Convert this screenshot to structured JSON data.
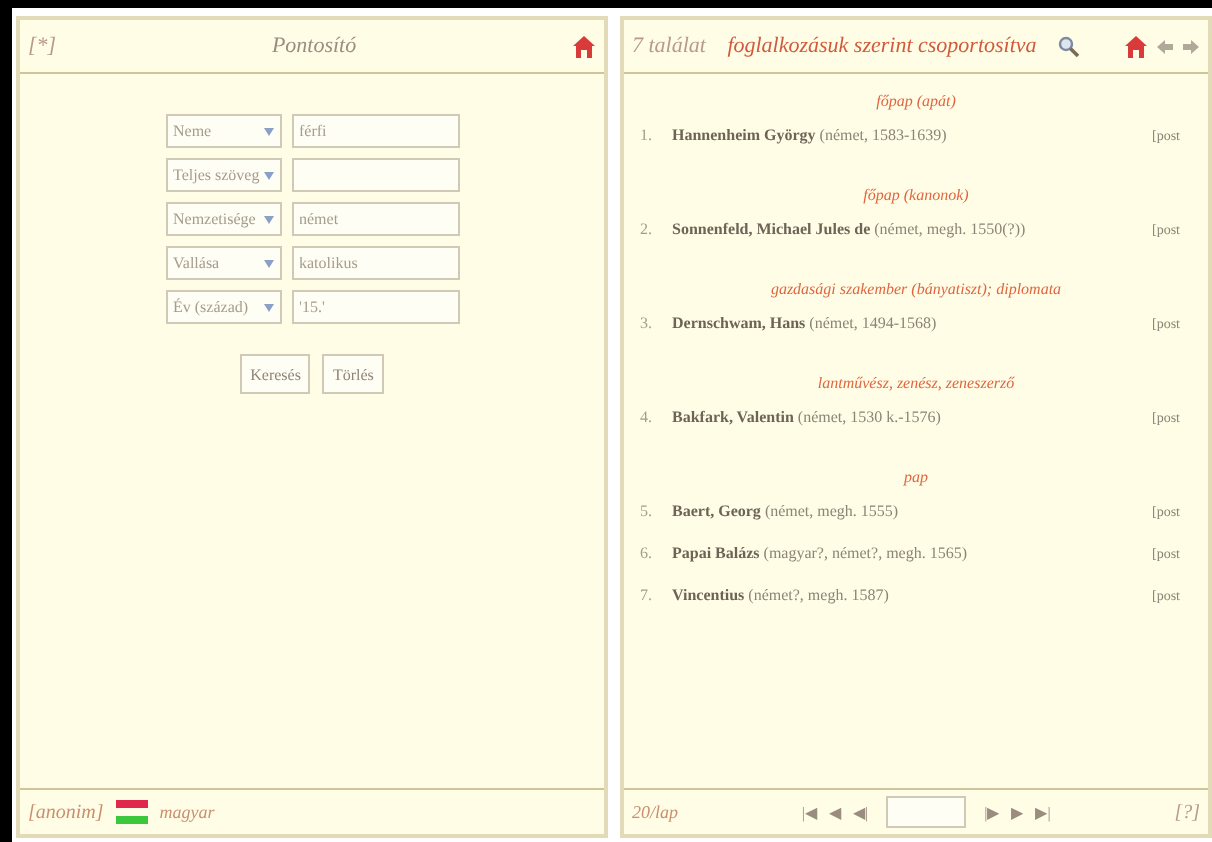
{
  "left_panel": {
    "marker": "[*]",
    "title": "Pontosító",
    "criteria": [
      {
        "field": "Neme",
        "value": "férfi"
      },
      {
        "field": "Teljes szöveg"
      },
      {
        "field": "Nemzetisége",
        "value": "német"
      },
      {
        "field": "Vallása",
        "value": "katolikus"
      },
      {
        "field": "Év (század)",
        "value": "'15.'"
      }
    ],
    "buttons": [
      "Keresés",
      "Törlés"
    ],
    "footer": {
      "user": "[anonim]",
      "language": "magyar"
    }
  },
  "right_panel": {
    "count": "7 találat",
    "title": "foglalkozásuk szerint csoportosítva",
    "groups": [
      {
        "label": "főpap (apát)",
        "entries": [
          {
            "number": "1.",
            "text": "**Hannenheim György** (német, 1583-1639)",
            "link": "[post"
          }
        ]
      },
      {
        "label": "főpap (kanonok)",
        "entries": [
          {
            "number": "2.",
            "text": "**Sonnenfeld, Michael Jules de** (német, megh. 1550(?))",
            "link": "[post"
          }
        ]
      },
      {
        "label": "gazdasági szakember (bányatiszt); diplomata",
        "entries": [
          {
            "number": "3.",
            "text": "**Dernschwam, Hans** (német, 1494-1568)",
            "link": "[post"
          }
        ]
      },
      {
        "label": "lantművész, zenész, zeneszerző",
        "entries": [
          {
            "number": "4.",
            "text": "**Bakfark, Valentin** (német, 1530 k.-1576)",
            "link": "[post"
          }
        ]
      },
      {
        "label": "pap",
        "entries": [
          {
            "number": "5.",
            "text": "**Baert, Georg** (német, megh. 1555)",
            "link": "[post"
          },
          {
            "number": "6.",
            "text": "**Papai Balázs** (magyar?, német?, megh. 1565)",
            "link": "[post"
          },
          {
            "number": "7.",
            "text": "**Vincentius** (német?, megh. 1587)",
            "link": "[post"
          }
        ]
      }
    ],
    "footer": {
      "per_page": "20/lap",
      "pager_back": [
        "|◀",
        "◀",
        "◀|"
      ],
      "pager_forward": [
        "|▶",
        "▶",
        "▶|"
      ],
      "help": "[?]"
    }
  }
}
